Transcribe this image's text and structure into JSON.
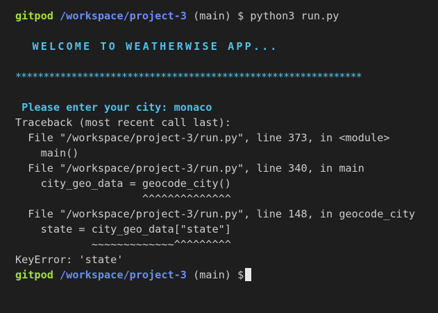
{
  "prompt": {
    "user": "gitpod",
    "path": "/workspace/project-3",
    "branch": "(main)",
    "symbol": "$"
  },
  "command": "python3 run.py",
  "app_output": {
    "welcome": "  WELCOME TO WEATHERWISE APP...",
    "stars": "**************************************************************",
    "city_prompt": " Please enter your city: monaco"
  },
  "traceback": {
    "header": "Traceback (most recent call last):",
    "lines": [
      "  File \"/workspace/project-3/run.py\", line 373, in <module>",
      "    main()",
      "  File \"/workspace/project-3/run.py\", line 340, in main",
      "    city_geo_data = geocode_city()",
      "                    ^^^^^^^^^^^^^^",
      "  File \"/workspace/project-3/run.py\", line 148, in geocode_city",
      "    state = city_geo_data[\"state\"]",
      "            ~~~~~~~~~~~~~^^^^^^^^^"
    ],
    "error": "KeyError: 'state'"
  }
}
